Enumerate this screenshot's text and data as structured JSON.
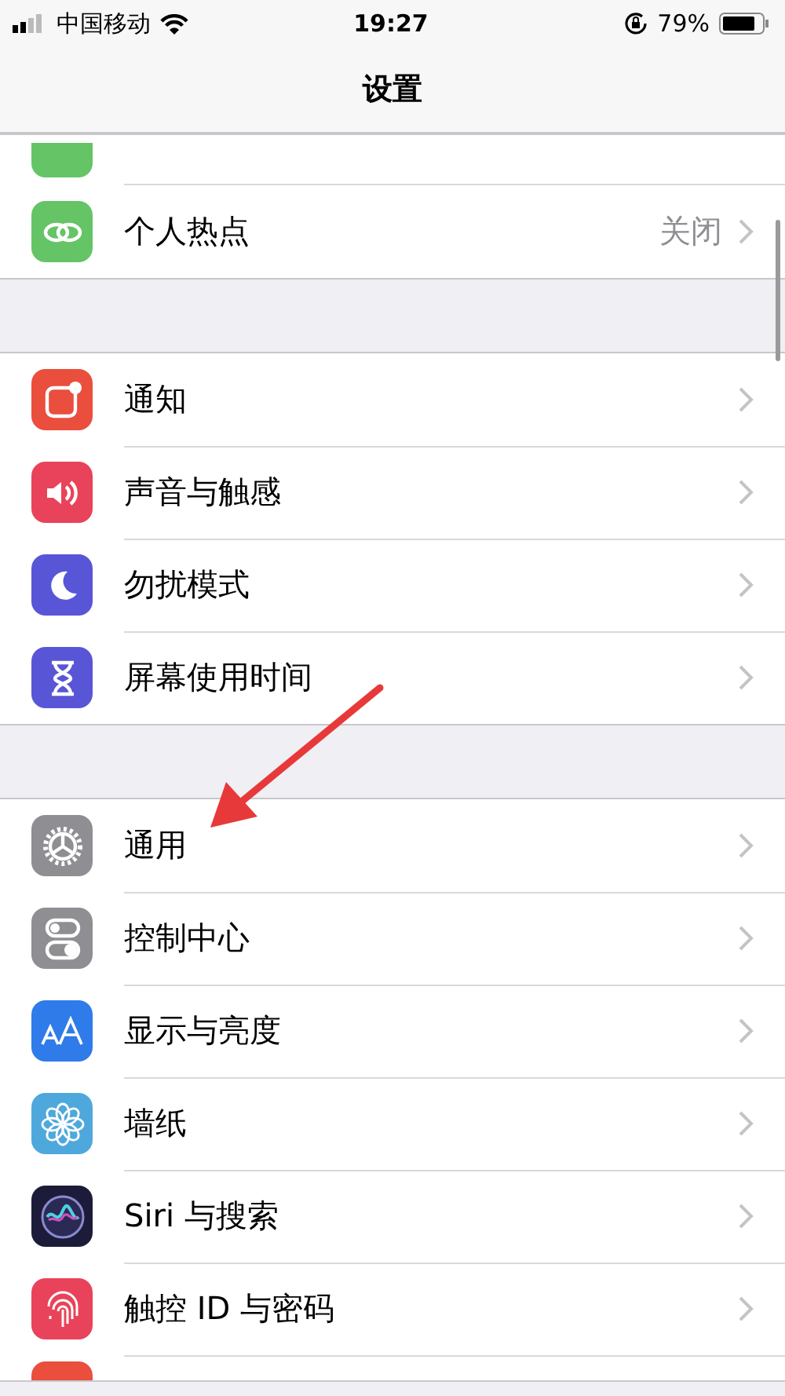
{
  "status_bar": {
    "carrier": "中国移动",
    "time": "19:27",
    "battery": "79%"
  },
  "nav": {
    "title": "设置"
  },
  "sections": [
    {
      "items": [
        {
          "kind": "clipped",
          "color": "#65c466"
        },
        {
          "label": "个人热点",
          "value": "关闭",
          "color": "#65c466"
        }
      ]
    },
    {
      "items": [
        {
          "label": "通知",
          "color": "#ea4e3d"
        },
        {
          "label": "声音与触感",
          "color": "#e8435a"
        },
        {
          "label": "勿扰模式",
          "color": "#5856d6"
        },
        {
          "label": "屏幕使用时间",
          "color": "#5856d6"
        }
      ]
    },
    {
      "items": [
        {
          "label": "通用",
          "color": "#8e8e93"
        },
        {
          "label": "控制中心",
          "color": "#8e8e93"
        },
        {
          "label": "显示与亮度",
          "color": "#2f7bea"
        },
        {
          "label": "墙纸",
          "color": "#4ea8dc"
        },
        {
          "label": "Siri 与搜索",
          "color": "#1c1c3a"
        },
        {
          "label": "触控 ID 与密码",
          "color": "#e8435a"
        },
        {
          "kind": "clipped",
          "color": "#ea4e3d"
        }
      ]
    }
  ]
}
